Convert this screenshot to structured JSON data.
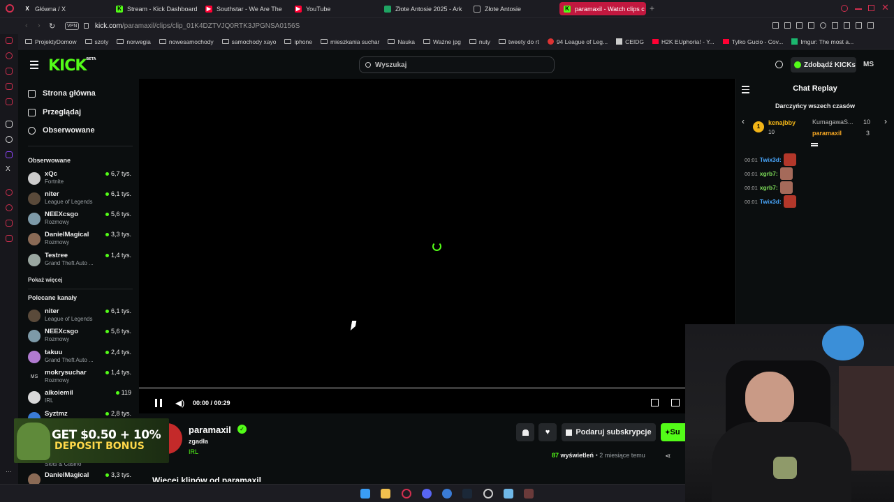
{
  "tabs": [
    {
      "label": "Główna / X",
      "icon": "x-icon",
      "color": "#ffffff"
    },
    {
      "label": "Stream - Kick Dashboard",
      "icon": "kick-icon",
      "color": "#53fc18"
    },
    {
      "label": "Southstar - We Are The P",
      "icon": "youtube-icon",
      "color": "#ff0033"
    },
    {
      "label": "YouTube",
      "icon": "youtube-icon",
      "color": "#ff0033"
    },
    {
      "label": "Złote Antosie 2025 - Ark",
      "icon": "sheets-icon",
      "color": "#1fa463"
    },
    {
      "label": "Złote Antosie",
      "icon": "page-icon",
      "color": "#aaaaaa"
    },
    {
      "label": "paramaxil - Watch clips c",
      "icon": "kick-icon",
      "color": "#53fc18",
      "active": true
    }
  ],
  "url": {
    "vpn": "VPN",
    "host": "kick.com",
    "path": "/paramaxil/clips/clip_01K4DZTVJQ0RTK3JPGNSA0156S"
  },
  "bookmarks": [
    "ProjektyDomow",
    "szoty",
    "norwegia",
    "nowesamochody",
    "samochody xayo",
    "iphone",
    "mieszkania suchar",
    "Nauka",
    "Ważne jpg",
    "nuty",
    "tweety do rt",
    "94 League of Leg...",
    "CEIDG",
    "H2K EUphoria! - Y...",
    "Tylko Gucio - Cov...",
    "Imgur: The most a..."
  ],
  "header": {
    "logo": "KICK",
    "logo_badge": "BETA",
    "search_placeholder": "Wyszukaj",
    "get_kicks": "Zdobądź KICKs",
    "avatar": "MS"
  },
  "nav": {
    "home": "Strona główna",
    "browse": "Przeglądaj",
    "following": "Obserwowane"
  },
  "followed": {
    "title": "Obserwowane",
    "show_more": "Pokaż więcej",
    "items": [
      {
        "name": "xQc",
        "game": "Fortnite",
        "viewers": "6,7 tys."
      },
      {
        "name": "niter",
        "game": "League of Legends",
        "viewers": "6,1 tys."
      },
      {
        "name": "NEEXcsgo",
        "game": "Rozmowy",
        "viewers": "5,6 tys."
      },
      {
        "name": "DanielMagical",
        "game": "Rozmowy",
        "viewers": "3,3 tys."
      },
      {
        "name": "Testree",
        "game": "Grand Theft Auto ...",
        "viewers": "1,4 tys."
      }
    ]
  },
  "recommended": {
    "title": "Polecane kanały",
    "items": [
      {
        "name": "niter",
        "game": "League of Legends",
        "viewers": "6,1 tys."
      },
      {
        "name": "NEEXcsgo",
        "game": "Rozmowy",
        "viewers": "5,6 tys."
      },
      {
        "name": "takuu",
        "game": "Grand Theft Auto ...",
        "viewers": "2,4 tys."
      },
      {
        "name": "mokrysuchar",
        "game": "Rozmowy",
        "viewers": "1,4 tys."
      },
      {
        "name": "aikoiemil",
        "game": "IRL",
        "viewers": "119"
      },
      {
        "name": "Syztmz",
        "game": "",
        "viewers": "2,8 tys."
      },
      {
        "name": "DanielMagical",
        "game": "Slots & Casino",
        "viewers": "3,3 tys."
      }
    ]
  },
  "player": {
    "time": "00:00 / 00:29",
    "progress": 0
  },
  "channel": {
    "name": "paramaxil",
    "clip_title": "zgadła",
    "category": "IRL",
    "subscribe_gift": "Podaruj subskrypcje",
    "subscribe": "Su",
    "views_count": "87",
    "views_label": "wyświetleń",
    "ago": "2 miesiące temu",
    "more_clips": "Więcej klipów od paramaxil"
  },
  "ad": {
    "line1": "GET $0.50 + 10%",
    "line2": "DEPOSIT BONUS"
  },
  "chat": {
    "title": "Chat Replay",
    "gifters_title": "Darczyńcy wszech czasów",
    "gifters": [
      {
        "rank": "1",
        "name": "kenajbby",
        "count": "10"
      },
      {
        "name": "KumagawaS...",
        "count": "10"
      },
      {
        "name": "paramaxil",
        "count": "3"
      }
    ],
    "messages": [
      {
        "time": "00:01",
        "user": "Twix3d:",
        "color": "#4aa8ff"
      },
      {
        "time": "00:01",
        "user": "xgrb7:",
        "color": "#7fe05a"
      },
      {
        "time": "00:01",
        "user": "xgrb7:",
        "color": "#7fe05a"
      },
      {
        "time": "00:01",
        "user": "Twix3d:",
        "color": "#4aa8ff"
      }
    ]
  },
  "colors": {
    "accent": "#53fc18",
    "active_tab": "#c2183f",
    "bg": "#0b0e0f"
  }
}
